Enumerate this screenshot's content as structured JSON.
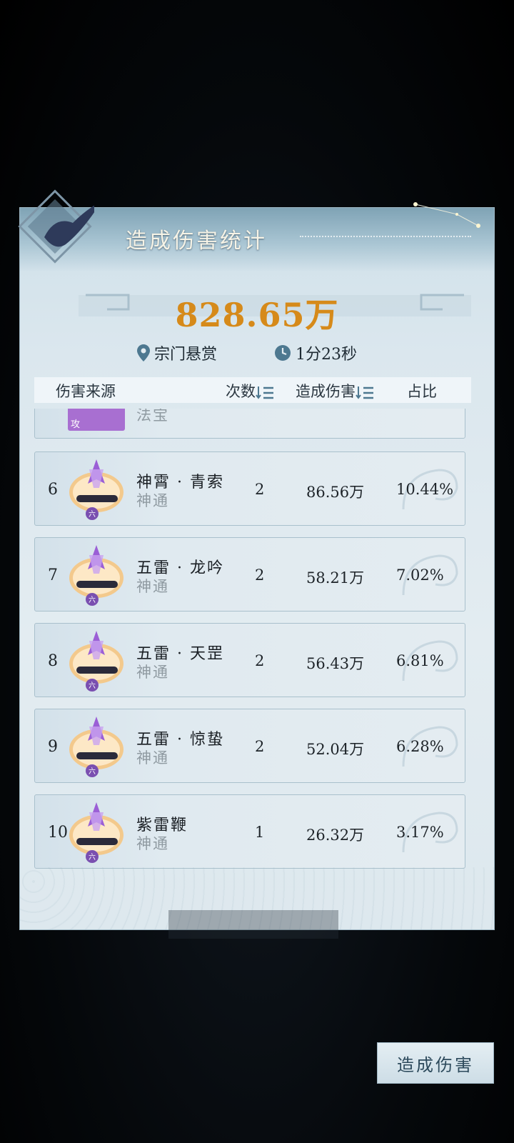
{
  "header": {
    "title": "造成伤害统计"
  },
  "summary": {
    "total_damage": "828.65万",
    "location": "宗门悬赏",
    "duration": "1分23秒"
  },
  "table": {
    "col_source": "伤害来源",
    "col_count": "次数",
    "col_damage": "造成伤害",
    "col_ratio": "占比"
  },
  "partial_row": {
    "type": "法宝",
    "badge": "攻"
  },
  "rows": [
    {
      "rank": "6",
      "name": "神霄 · 青索",
      "type": "神通",
      "count": "2",
      "damage": "86.56万",
      "ratio": "10.44%"
    },
    {
      "rank": "7",
      "name": "五雷 · 龙吟",
      "type": "神通",
      "count": "2",
      "damage": "58.21万",
      "ratio": "7.02%"
    },
    {
      "rank": "8",
      "name": "五雷 · 天罡",
      "type": "神通",
      "count": "2",
      "damage": "56.43万",
      "ratio": "6.81%"
    },
    {
      "rank": "9",
      "name": "五雷 · 惊蛰",
      "type": "神通",
      "count": "2",
      "damage": "52.04万",
      "ratio": "6.28%"
    },
    {
      "rank": "10",
      "name": "紫雷鞭",
      "type": "神通",
      "count": "1",
      "damage": "26.32万",
      "ratio": "3.17%"
    }
  ],
  "footer": {
    "button_label": "造成伤害"
  },
  "colors": {
    "accent_gold": "#d68a1a",
    "panel": "#dbe7ee",
    "skill_purple": "#9b5fd6"
  },
  "icons": [
    "location-pin-icon",
    "clock-icon",
    "sort-desc-icon",
    "skill-icon",
    "emblem-icon"
  ]
}
